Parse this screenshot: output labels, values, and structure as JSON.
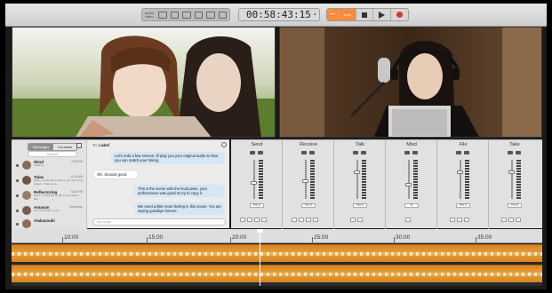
{
  "toolbar": {
    "views": [
      "audio",
      "video"
    ],
    "timecode": "00:58:43:15",
    "transport": {
      "sync_label": "sync"
    }
  },
  "chat": {
    "tabs": [
      "Messages",
      "Contacts"
    ],
    "search_placeholder": "Search",
    "to_label": "To:",
    "to_name": "Label",
    "contacts": [
      {
        "name": "Wind",
        "time": "7:26 PM",
        "preview": "Label is..."
      },
      {
        "name": "Talas",
        "time": "6:10 AM",
        "preview": "Hello, I would like to talk to you about this project. I had some..."
      },
      {
        "name": "Reflectoring",
        "time": "5:26 PM",
        "preview": "Hello, I would like to talk to you about the..."
      },
      {
        "name": "Amasan",
        "time": "Yesterday",
        "preview": "Just checking on you..."
      },
      {
        "name": "Alabazouki",
        "time": "",
        "preview": ""
      }
    ],
    "messages": [
      {
        "dir": "out",
        "text": "Let's redo a few scenes. I'll play you your original audio so that you can match your timing."
      },
      {
        "dir": "in",
        "text": "OK. Sounds good."
      },
      {
        "dir": "out",
        "text": "This is the scene with the loud piano, your performance was good so try to copy it."
      },
      {
        "dir": "out",
        "text": "We need a little more feeling in this scene. You are saying goodbye forever."
      }
    ],
    "input_placeholder": "Message"
  },
  "mixer": {
    "channels": [
      {
        "label": "Send",
        "pan": "Pre S"
      },
      {
        "label": "Receive",
        "pan": "Pre S"
      },
      {
        "label": "Talk",
        "pan": "Pre S"
      },
      {
        "label": "Mixd",
        "pan": "M"
      },
      {
        "label": "File",
        "pan": "Pre S"
      },
      {
        "label": "Take",
        "pan": "Pre S"
      }
    ]
  },
  "timeline": {
    "ticks": [
      "10:00",
      "15:00",
      "20:00",
      "25:00",
      "30:00",
      "35:00"
    ]
  },
  "colors": {
    "accent": "#ff8a3c",
    "track": "#e29a3a",
    "record": "#e53030"
  }
}
